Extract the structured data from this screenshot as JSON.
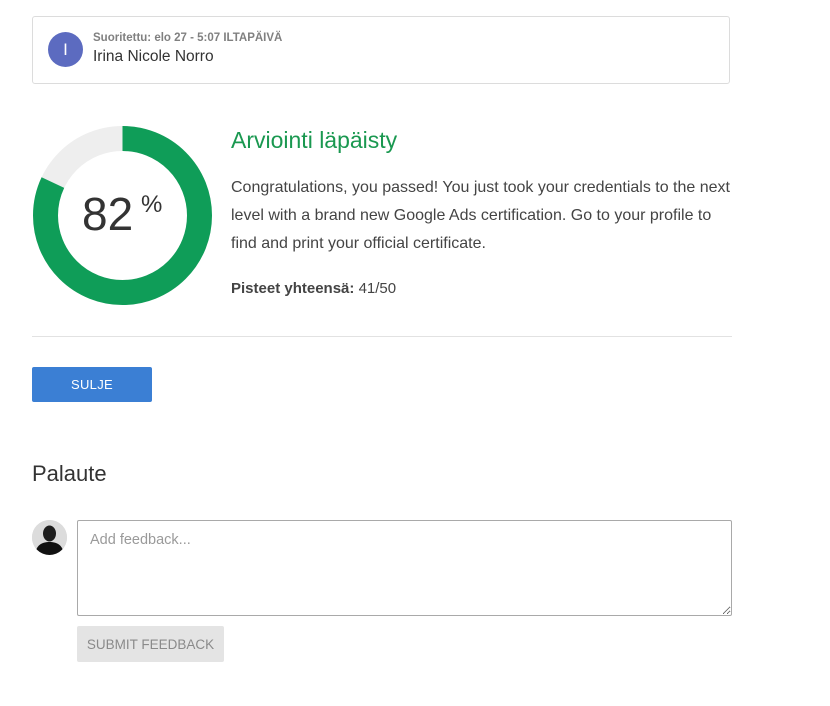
{
  "submission": {
    "avatar_initial": "I",
    "submitted_label": "Suoritettu: elo 27 - 5:07 ILTAPÄIVÄ",
    "name": "Irina Nicole Norro"
  },
  "result": {
    "score_value": "82",
    "score_unit": "%",
    "score_fraction": 0.82,
    "title": "Arviointi läpäisty",
    "message": "Congratulations, you passed! You just took your credentials to the next level with a brand new Google Ads certification. Go to your profile to find and print your official certificate.",
    "total_label": "Pisteet yhteensä:",
    "total_value": "41/50"
  },
  "actions": {
    "close_label": "SULJE"
  },
  "feedback": {
    "heading": "Palaute",
    "placeholder": "Add feedback...",
    "value": "",
    "submit_label": "SUBMIT FEEDBACK"
  },
  "colors": {
    "ring_fill": "#0f9d58",
    "ring_track": "#eeeeee",
    "pass_title": "#1a9850",
    "close_button": "#3b7fd4",
    "avatar_initial_bg": "#5c6bc0"
  },
  "icons": {
    "user_avatar": "person-silhouette-icon"
  }
}
